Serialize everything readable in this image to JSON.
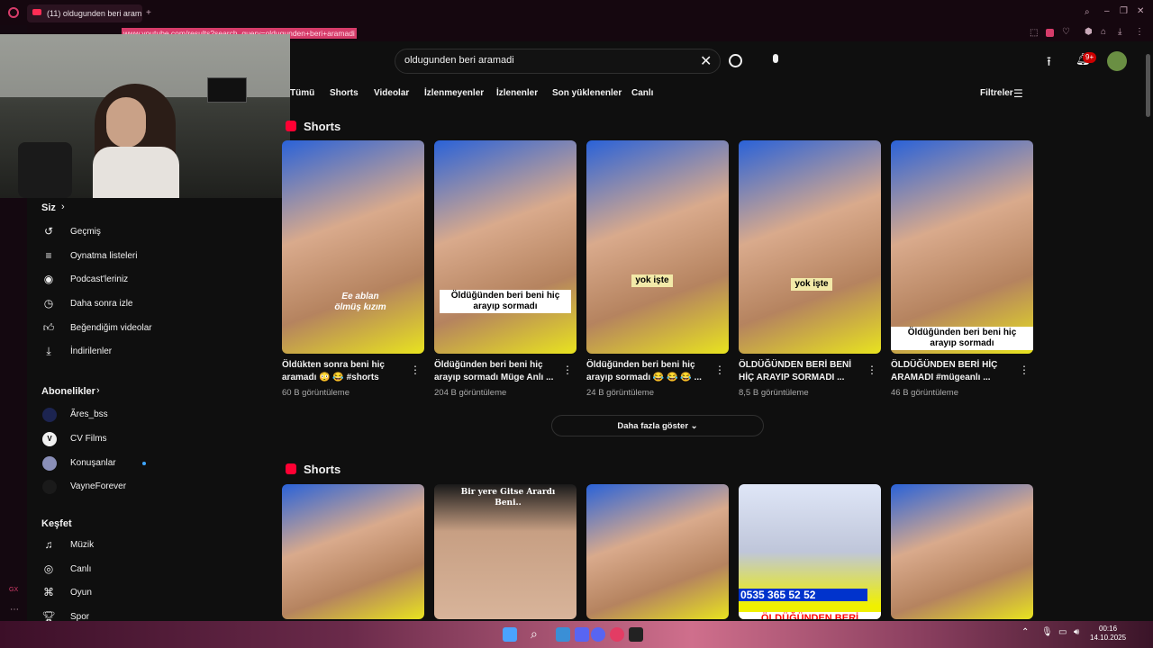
{
  "browser": {
    "tab_title": "(11) oldugunden beri aram",
    "url": "www.youtube.com/results?search_query=oldugunden+beri+aramadi",
    "notification_badge": "9+",
    "gx_label": "GX"
  },
  "search": {
    "value": "oldugunden beri aramadi"
  },
  "chips": [
    "Tümü",
    "Shorts",
    "Videolar",
    "İzlenmeyenler",
    "İzlenenler",
    "Son yüklenenler",
    "Canlı"
  ],
  "filters_label": "Filtreler",
  "sidebar": {
    "you_title": "Siz",
    "you_items": [
      "Geçmiş",
      "Oynatma listeleri",
      "Podcast'leriniz",
      "Daha sonra izle",
      "Beğendiğim videolar",
      "İndirilenler"
    ],
    "subs_title": "Abonelikler",
    "subs_items": [
      "Ãres_bss",
      "CV Films",
      "Konuşanlar",
      "VayneForever"
    ],
    "explore_title": "Keşfet",
    "explore_items": [
      "Müzik",
      "Canlı",
      "Oyun",
      "Spor"
    ]
  },
  "section1": {
    "title": "Shorts",
    "items": [
      {
        "title": "Öldükten sonra beni hiç aramadı 😳 😂 #shorts",
        "views": "60 B görüntüleme",
        "caption": "Ee ablan ölmüş kızım"
      },
      {
        "title": "Öldüğünden beri beni hiç arayıp sormadı Müge Anlı ...",
        "views": "204 B görüntüleme",
        "caption": "Öldüğünden beri beni hiç arayıp sormadı"
      },
      {
        "title": "Öldüğünden beri beni hiç arayıp sormadı 😂 😂 😂 ...",
        "views": "24 B görüntüleme",
        "caption": "yok işte"
      },
      {
        "title": "ÖLDÜĞÜNDEN BERİ BENİ HİÇ ARAYIP SORMADI ...",
        "views": "8,5 B görüntüleme",
        "caption": "yok işte"
      },
      {
        "title": "ÖLDÜĞÜNDEN BERİ HİÇ ARAMADI #mügeanlı ...",
        "views": "46 B görüntüleme",
        "caption": "Öldüğünden beri beni hiç arayıp sormadı"
      }
    ],
    "more_label": "Daha fazla göster"
  },
  "section2": {
    "title": "Shorts",
    "captions": [
      "",
      "Bir yere Gitse Arardı Beni..",
      "",
      "0535 365 52 52",
      ""
    ],
    "banner": "ÖLDÜĞÜNDEN BERİ"
  },
  "taskbar": {
    "time": "00:16",
    "date": "14.10.2025"
  },
  "colors": {
    "accent": "#ff0033",
    "background": "#0f0f0f",
    "url_highlight": "#d63c6a"
  }
}
